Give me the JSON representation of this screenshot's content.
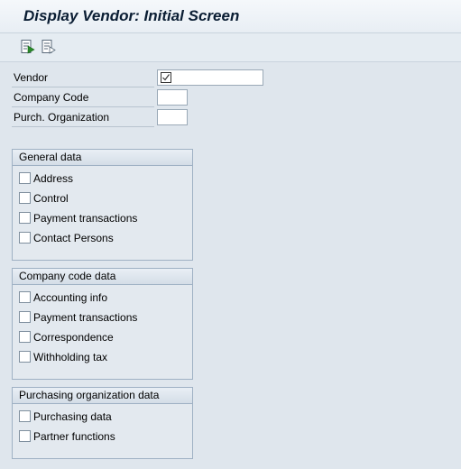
{
  "title": "Display Vendor:  Initial Screen",
  "toolbar": {
    "buttons": [
      {
        "name": "execute-icon"
      },
      {
        "name": "display-document-icon"
      }
    ]
  },
  "fields": {
    "vendor": {
      "label": "Vendor",
      "value": ""
    },
    "company_code": {
      "label": "Company Code",
      "value": ""
    },
    "purch_org": {
      "label": "Purch. Organization",
      "value": ""
    }
  },
  "groups": {
    "general": {
      "title": "General data",
      "items": [
        {
          "label": "Address",
          "checked": false
        },
        {
          "label": "Control",
          "checked": false
        },
        {
          "label": "Payment transactions",
          "checked": false
        },
        {
          "label": "Contact Persons",
          "checked": false
        }
      ]
    },
    "company": {
      "title": "Company code data",
      "items": [
        {
          "label": "Accounting info",
          "checked": false
        },
        {
          "label": "Payment transactions",
          "checked": false
        },
        {
          "label": "Correspondence",
          "checked": false
        },
        {
          "label": "Withholding tax",
          "checked": false
        }
      ]
    },
    "purchasing": {
      "title": "Purchasing organization data",
      "items": [
        {
          "label": "Purchasing data",
          "checked": false
        },
        {
          "label": "Partner functions",
          "checked": false
        }
      ]
    }
  }
}
